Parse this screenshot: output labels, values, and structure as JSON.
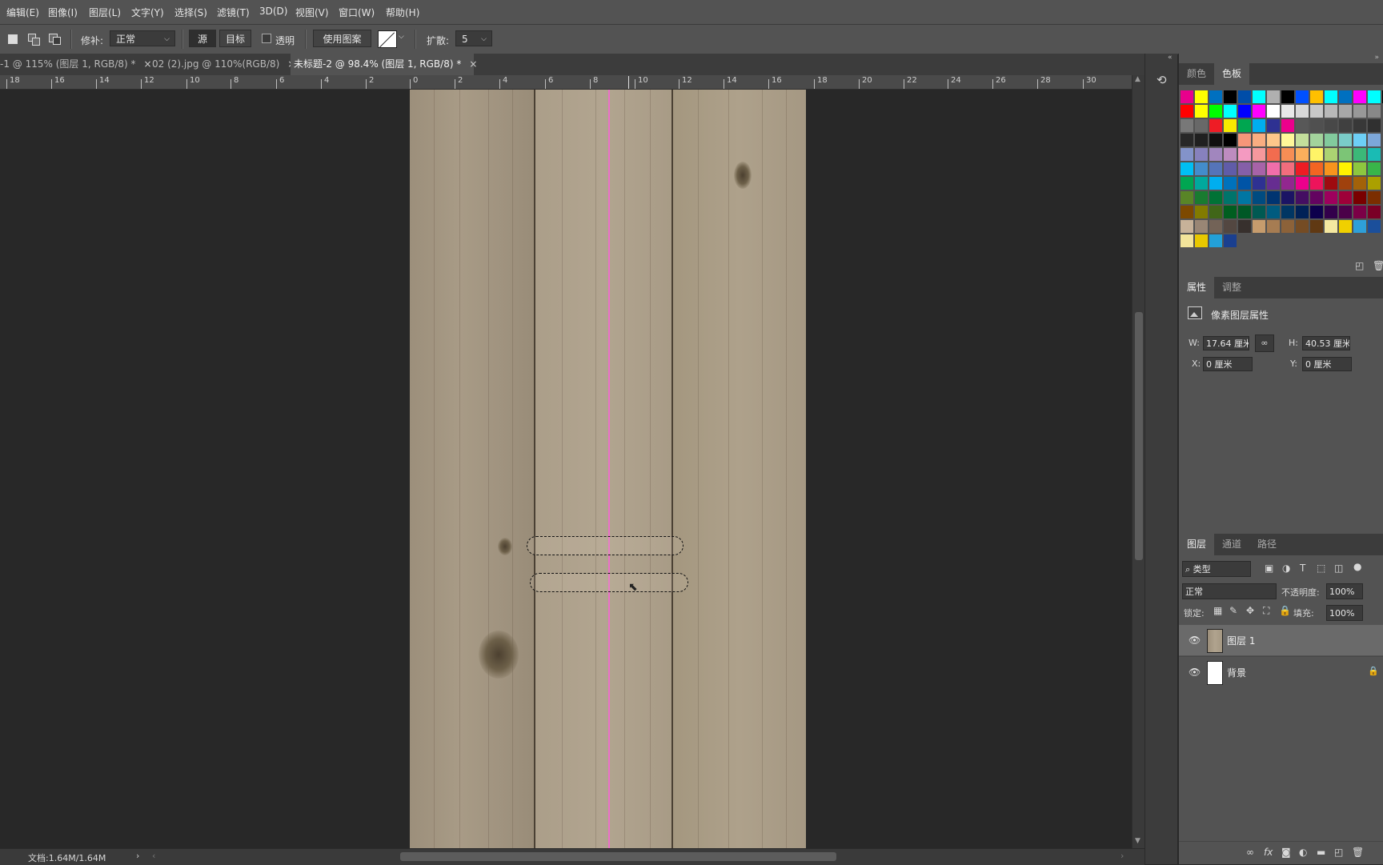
{
  "menu": [
    "编辑(E)",
    "图像(I)",
    "图层(L)",
    "文字(Y)",
    "选择(S)",
    "滤镜(T)",
    "3D(D)",
    "视图(V)",
    "窗口(W)",
    "帮助(H)"
  ],
  "options": {
    "mode_label": "修补:",
    "mode_value": "正常",
    "source_label": "源",
    "target_label": "目标",
    "transparent_label": "透明",
    "use_pattern_label": "使用图案",
    "diffusion_label": "扩散:",
    "diffusion_value": "5"
  },
  "tabs": [
    {
      "label": "-1 @ 115% (图层 1, RGB/8) *",
      "active": false
    },
    {
      "label": "02 (2).jpg @ 110%(RGB/8)",
      "active": false
    },
    {
      "label": "未标题-2 @ 98.4% (图层 1, RGB/8) *",
      "active": true
    }
  ],
  "ruler": [
    "18",
    "16",
    "14",
    "12",
    "10",
    "8",
    "6",
    "4",
    "2",
    "0",
    "2",
    "4",
    "6",
    "8",
    "10",
    "12",
    "14",
    "16",
    "18",
    "20",
    "22",
    "24",
    "26",
    "28",
    "30"
  ],
  "status": {
    "doc": "文档:1.64M/1.64M"
  },
  "swatches_panel": {
    "tabs": [
      "颜色",
      "色板"
    ],
    "active": "色板",
    "rows": [
      [
        "#e8008c",
        "#ffff00",
        "#0070c0",
        "#000000",
        "#004da8",
        "#00ffff",
        "#b0b0b0",
        "#000000",
        "#0050ff",
        "#ffc000",
        "#00ffff",
        "#0070c0",
        "#ff00ff",
        "#00ffff",
        "#000000",
        "#ffffff"
      ],
      [
        "#ff0000",
        "#ffff00",
        "#00ff00",
        "#00ffff",
        "#0000ff",
        "#ff00ff",
        "#ffffff",
        "#e8e8e8",
        "#d8d8d8",
        "#c8c8c8",
        "#b8b8b8",
        "#a8a8a8",
        "#989898",
        "#888888"
      ],
      [
        "#787878",
        "#686868",
        "#ee1c25",
        "#f7ea00",
        "#00a650",
        "#00aeef",
        "#2e3192",
        "#ec008c",
        "#585858",
        "#505050",
        "#484848",
        "#404040",
        "#383838",
        "#303030"
      ],
      [
        "#282828",
        "#202020",
        "#101010",
        "#000000",
        "#f69679",
        "#f9ad81",
        "#fdc68a",
        "#fff799",
        "#c4df9b",
        "#a3d39c",
        "#82ca9d",
        "#7accc8",
        "#6dcff6",
        "#7da7d9"
      ],
      [
        "#8393ca",
        "#8781bd",
        "#a186be",
        "#bd8cbf",
        "#f49ac1",
        "#f5989d",
        "#f26c4f",
        "#f68e55",
        "#fbaf5c",
        "#fff467",
        "#acd372",
        "#7cc576",
        "#3bb878",
        "#1abbb4"
      ],
      [
        "#00bff3",
        "#438ccb",
        "#5574b9",
        "#605ca8",
        "#855fa8",
        "#a763a8",
        "#f06eaa",
        "#f26d7d",
        "#ed1c24",
        "#f26522",
        "#f7941d",
        "#fff200",
        "#8dc73f",
        "#39b54a"
      ],
      [
        "#00a651",
        "#00a99d",
        "#00aeef",
        "#0072bc",
        "#0054a6",
        "#2e3192",
        "#662d91",
        "#92278f",
        "#ec008c",
        "#ed145b",
        "#9e0b0f",
        "#a0410d",
        "#a36209",
        "#aba000"
      ],
      [
        "#598527",
        "#197b30",
        "#007236",
        "#00746b",
        "#0076a3",
        "#004b80",
        "#003471",
        "#1b1464",
        "#440e62",
        "#630460",
        "#9e005d",
        "#9e0039",
        "#790000",
        "#7b2e00"
      ],
      [
        "#7d4900",
        "#827b00",
        "#406618",
        "#005e20",
        "#005826",
        "#005952",
        "#005b7f",
        "#003663",
        "#002157",
        "#0d004c",
        "#32004b",
        "#4b0049",
        "#7b0046",
        "#7a0026"
      ],
      [
        "#c7b299",
        "#998675",
        "#736357",
        "#534741",
        "#37302d",
        "#c69c6d",
        "#a67c52",
        "#8c6239",
        "#754c24",
        "#603913",
        "#f5e8a0",
        "#f0d000",
        "#2e9fd8",
        "#1b4f9b"
      ],
      [
        "#f2e49a",
        "#e8c800",
        "#23a0d8",
        "#1a3f8f"
      ]
    ]
  },
  "properties_panel": {
    "tabs": [
      "属性",
      "调整"
    ],
    "title": "像素图层属性",
    "w_label": "W:",
    "w_value": "17.64 厘米",
    "h_label": "H:",
    "h_value": "40.53 厘米",
    "x_label": "X:",
    "x_value": "0 厘米",
    "y_label": "Y:",
    "y_value": "0 厘米"
  },
  "layers_panel": {
    "tabs": [
      "图层",
      "通道",
      "路径"
    ],
    "filter_value": "类型",
    "blend_mode": "正常",
    "opacity_label": "不透明度:",
    "opacity_value": "100%",
    "lock_label": "锁定:",
    "fill_label": "填充:",
    "fill_value": "100%",
    "layers": [
      {
        "name": "图层 1",
        "selected": true
      },
      {
        "name": "背景",
        "selected": false
      }
    ]
  },
  "colors": {
    "guide": "#ec6fc9",
    "wood": "#a79a86"
  }
}
